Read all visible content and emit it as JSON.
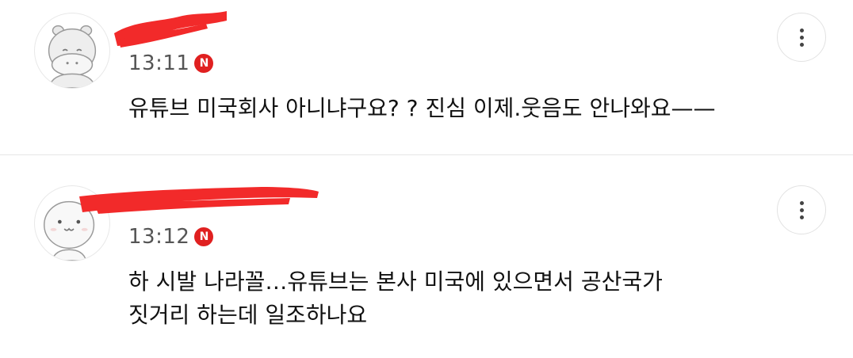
{
  "comments": [
    {
      "time": "13:11",
      "badge": "N",
      "text_lines": [
        "유튜브 미국회사 아니냐구요? ? 진심 이제.웃음도 안나와요——"
      ],
      "avatar_icon": "hippo-avatar-icon",
      "more_icon": "more-vertical-icon"
    },
    {
      "time": "13:12",
      "badge": "N",
      "text_lines": [
        "하 시발 나라꼴…유튜브는 본사 미국에 있으면서 공산국가",
        "짓거리 하는데 일조하나요"
      ],
      "avatar_icon": "cat-face-avatar-icon",
      "more_icon": "more-vertical-icon"
    }
  ],
  "colors": {
    "badge": "#e02020",
    "redaction": "#f22a2a",
    "time": "#555555",
    "divider": "#e6e6e6"
  }
}
